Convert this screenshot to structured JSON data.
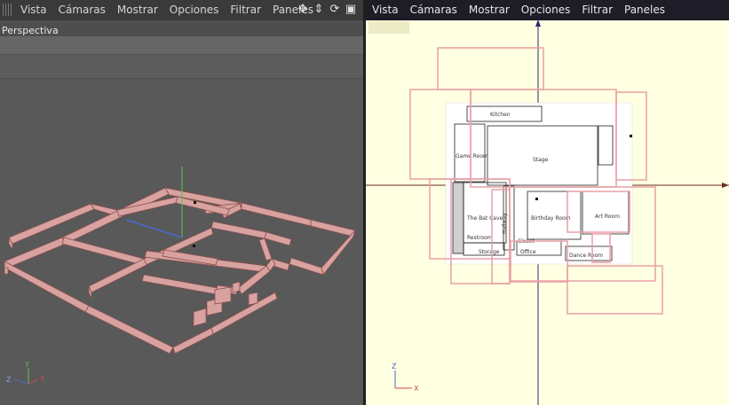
{
  "left_view": {
    "menu": [
      "Vista",
      "Cámaras",
      "Mostrar",
      "Opciones",
      "Filtrar",
      "Paneles"
    ],
    "nav_icons": [
      "move-icon",
      "zoom-icon",
      "rotate-icon",
      "maximize-icon"
    ],
    "view_label": "Perspectiva",
    "axis": {
      "x": "X",
      "y": "Y",
      "z": "Z"
    }
  },
  "right_view": {
    "menu": [
      "Vista",
      "Cámaras",
      "Mostrar",
      "Opciones",
      "Filtrar",
      "Paneles"
    ],
    "axis": {
      "x": "X",
      "z": "Z"
    },
    "rooms": {
      "kitchen": "Kitchen",
      "game_room": "Game Room",
      "stage": "Stage",
      "bat_cave": "The Bat Cave",
      "birthday_room": "Birthday Room",
      "art_room": "Art Room",
      "dance_room": "Dance Room",
      "restroom": "Restroom",
      "storage": "Storage",
      "office": "Office",
      "hallway": "Hallway",
      "closet": "Closet"
    }
  },
  "colors": {
    "wall": "#d7a29f",
    "wall_outline": "#8a4f4f",
    "selection": "#e8a0a6",
    "axis_x": "#c94a4a",
    "axis_y": "#5ac25a",
    "axis_z": "#4a6ad0",
    "right_bg": "#ffffe1"
  }
}
